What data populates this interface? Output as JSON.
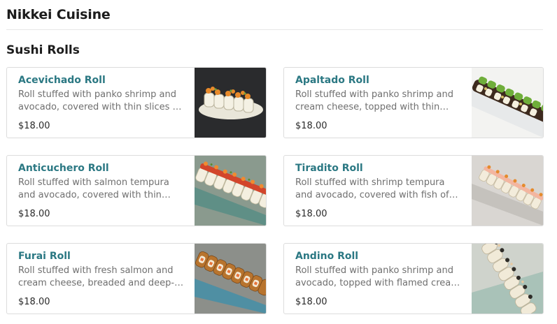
{
  "section": {
    "title": "Nikkei Cuisine"
  },
  "subsection": {
    "title": "Sushi Rolls"
  },
  "items": [
    {
      "name": "Acevichado Roll",
      "description": "Roll stuffed with panko shrimp and avocado, covered with thin slices …",
      "price": "$18.00",
      "image": "sushi-roll-photo"
    },
    {
      "name": "Apaltado Roll",
      "description": "Roll stuffed with panko shrimp and cream cheese, topped with thin…",
      "price": "$18.00",
      "image": "sushi-roll-photo"
    },
    {
      "name": "Anticuchero Roll",
      "description": "Roll stuffed with salmon tempura and avocado, covered with thin…",
      "price": "$18.00",
      "image": "sushi-roll-photo"
    },
    {
      "name": "Tiradito Roll",
      "description": "Roll stuffed with shrimp tempura and avocado, covered with fish of…",
      "price": "$18.00",
      "image": "sushi-roll-photo"
    },
    {
      "name": "Furai Roll",
      "description": "Roll stuffed with fresh salmon and cream cheese, breaded and deep-…",
      "price": "$18.00",
      "image": "sushi-roll-photo"
    },
    {
      "name": "Andino Roll",
      "description": "Roll stuffed with panko shrimp and avocado, topped with flamed crea…",
      "price": "$18.00",
      "image": "sushi-roll-photo"
    }
  ]
}
